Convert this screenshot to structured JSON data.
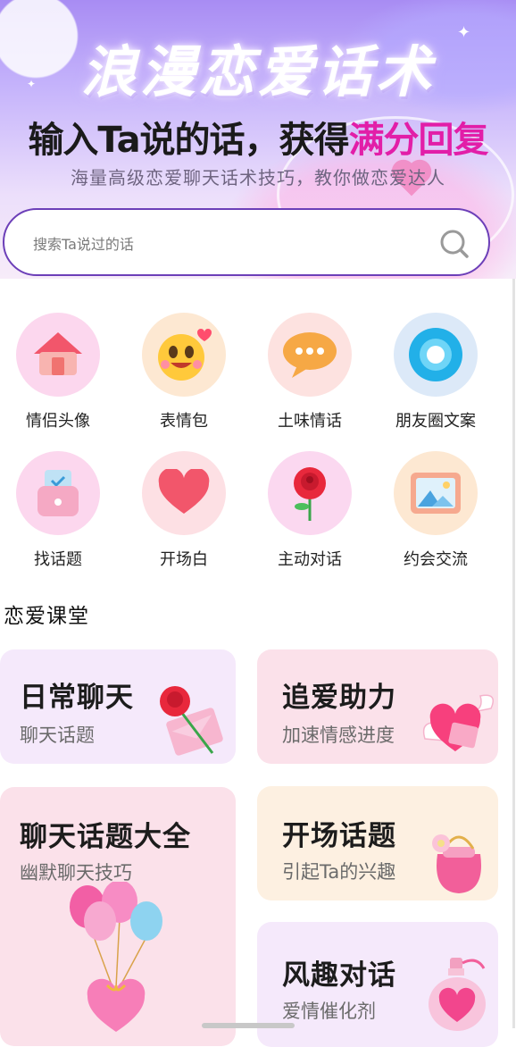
{
  "hero": {
    "title": "浪漫恋爱话术",
    "headline_main": "输入Ta说的话，获得",
    "headline_accent": "满分回复",
    "subtitle": "海量高级恋爱聊天话术技巧，教你做恋爱达人"
  },
  "search": {
    "placeholder": "搜索Ta说过的话",
    "value": ""
  },
  "categories": [
    {
      "label": "情侣头像",
      "icon": "house-icon"
    },
    {
      "label": "表情包",
      "icon": "emoji-face-icon"
    },
    {
      "label": "土味情话",
      "icon": "chat-bubble-icon"
    },
    {
      "label": "朋友圈文案",
      "icon": "camera-lens-icon"
    },
    {
      "label": "找话题",
      "icon": "wallet-icon"
    },
    {
      "label": "开场白",
      "icon": "heart-icon"
    },
    {
      "label": "主动对话",
      "icon": "rose-icon"
    },
    {
      "label": "约会交流",
      "icon": "picture-frame-icon"
    }
  ],
  "course": {
    "section_title": "恋爱课堂",
    "cards": [
      {
        "title": "日常聊天",
        "subtitle": "聊天话题",
        "icon": "rose-envelope-icon"
      },
      {
        "title": "追爱助力",
        "subtitle": "加速情感进度",
        "icon": "winged-heart-icon"
      },
      {
        "title": "聊天话题大全",
        "subtitle": "幽默聊天技巧",
        "icon": "heart-balloons-icon"
      },
      {
        "title": "开场话题",
        "subtitle": "引起Ta的兴趣",
        "icon": "gift-bag-icon"
      },
      {
        "title": "风趣对话",
        "subtitle": "爱情催化剂",
        "icon": "heart-perfume-icon"
      }
    ]
  },
  "colors": {
    "accent_magenta": "#e21ea8",
    "search_border": "#6c3fb8",
    "card_lavender": "#f5e9fb",
    "card_pink": "#fbe1ea",
    "card_peach": "#fdf0e1"
  }
}
